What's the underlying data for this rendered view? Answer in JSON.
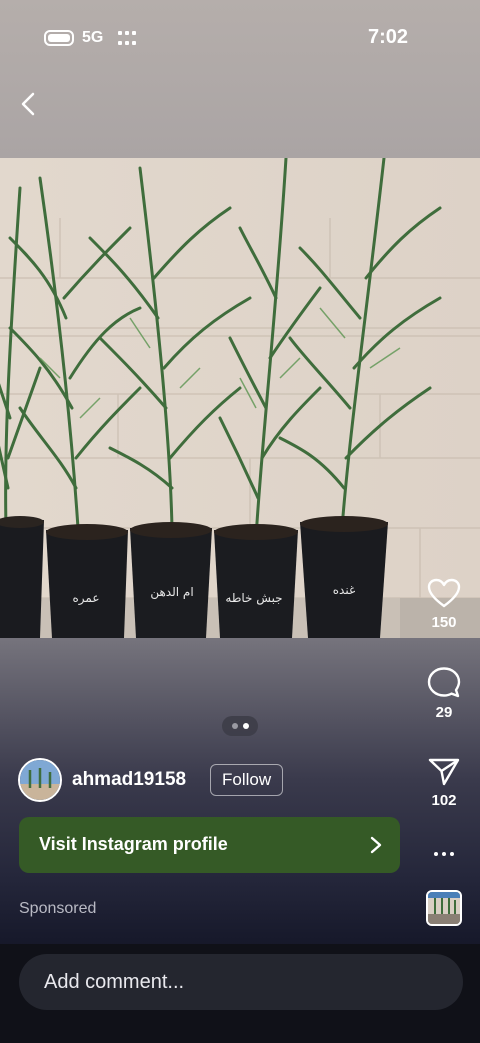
{
  "status_bar": {
    "network": "5G",
    "time": "7:02"
  },
  "post": {
    "likes": "150",
    "comments": "29",
    "shares": "102",
    "pager": {
      "count": 2,
      "active": 2
    },
    "pot_labels": [
      "عمره",
      "ام الدهن",
      "جبش خاطه",
      "غنده"
    ]
  },
  "author": {
    "username": "ahmad19158",
    "follow_label": "Follow"
  },
  "cta": {
    "label": "Visit Instagram profile",
    "color": "#355a26"
  },
  "sponsored_label": "Sponsored",
  "comment": {
    "placeholder": "Add comment..."
  },
  "icons": {
    "back": "chevron-left-icon",
    "like": "heart-icon",
    "comment": "comment-bubble-icon",
    "share": "paper-plane-icon",
    "more": "more-dots-icon"
  }
}
